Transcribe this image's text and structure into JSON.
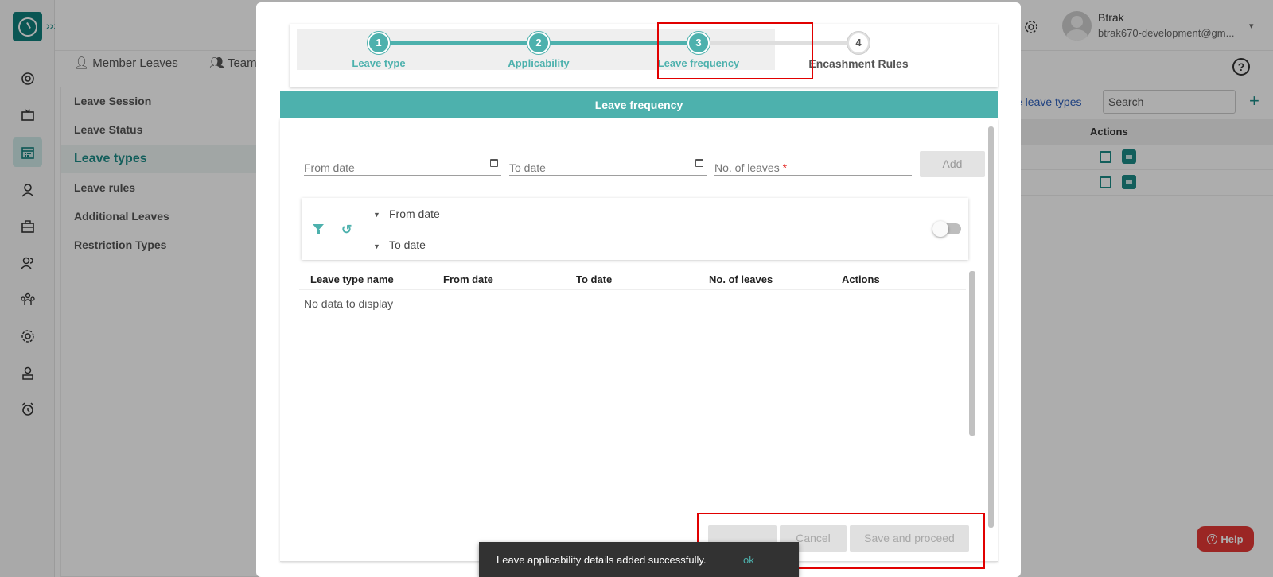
{
  "topbar": {
    "user_name": "Btrak",
    "user_email": "btrak670-development@gm..."
  },
  "subtabs": [
    "Member Leaves",
    "Team"
  ],
  "sidebar": {
    "items": [
      {
        "label": "Leave Session",
        "active": false
      },
      {
        "label": "Leave Status",
        "active": false
      },
      {
        "label": "Leave types",
        "active": true
      },
      {
        "label": "Leave rules",
        "active": false
      },
      {
        "label": "Additional Leaves",
        "active": false
      },
      {
        "label": "Restriction Types",
        "active": false
      }
    ]
  },
  "right_panel": {
    "active_link": "ve leave types",
    "search_placeholder": "Search",
    "actions_header": "Actions"
  },
  "stepper": {
    "steps": [
      {
        "number": "1",
        "label": "Leave type",
        "state": "done"
      },
      {
        "number": "2",
        "label": "Applicability",
        "state": "done"
      },
      {
        "number": "3",
        "label": "Leave frequency",
        "state": "active"
      },
      {
        "number": "4",
        "label": "Encashment Rules",
        "state": "pending"
      }
    ]
  },
  "form": {
    "section_title": "Leave frequency",
    "from_date_label": "From date",
    "to_date_label": "To date",
    "no_of_leaves_label": "No. of leaves",
    "required_mark": "*",
    "add_button": "Add"
  },
  "filter": {
    "sort_from": "From date",
    "sort_to": "To date"
  },
  "grid": {
    "columns": [
      "Leave type name",
      "From date",
      "To date",
      "No. of leaves",
      "Actions"
    ],
    "empty_message": "No data to display"
  },
  "footer_buttons": {
    "cancel": "Cancel",
    "save_and_proceed": "Save and proceed"
  },
  "snackbar": {
    "message": "Leave applicability details added successfully.",
    "action": "ok"
  },
  "help_button": "Help",
  "colors": {
    "accent": "#4db1ad",
    "brand_dark": "#0f7f7c",
    "highlight_box": "#e10000",
    "help_button": "#e53935"
  }
}
